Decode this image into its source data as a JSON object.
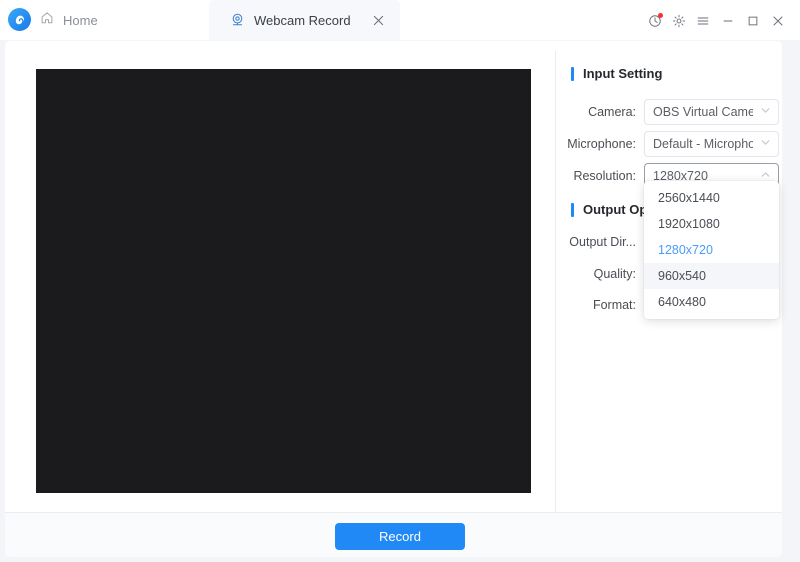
{
  "app": {
    "logo_icon": "app-logo-icon",
    "home_label": "Home"
  },
  "tab": {
    "icon": "webcam-icon",
    "label": "Webcam Record",
    "close_icon": "close-icon"
  },
  "window_controls": [
    {
      "name": "history-icon",
      "badge": true
    },
    {
      "name": "gear-icon",
      "badge": false
    },
    {
      "name": "menu-icon",
      "badge": false
    },
    {
      "name": "minimize-icon",
      "badge": false
    },
    {
      "name": "maximize-icon",
      "badge": false
    },
    {
      "name": "close-icon",
      "badge": false
    }
  ],
  "input_setting": {
    "title": "Input Setting",
    "camera_label": "Camera:",
    "camera_value": "OBS Virtual Camera",
    "microphone_label": "Microphone:",
    "microphone_value": "Default - Microphon...",
    "resolution_label": "Resolution:",
    "resolution_value": "1280x720"
  },
  "output_options": {
    "title": "Output Op",
    "output_dir_label": "Output Dir...",
    "quality_label": "Quality:",
    "format_label": "Format:"
  },
  "resolution_dropdown": {
    "options": [
      {
        "label": "2560x1440",
        "state": "normal"
      },
      {
        "label": "1920x1080",
        "state": "normal"
      },
      {
        "label": "1280x720",
        "state": "selected"
      },
      {
        "label": "960x540",
        "state": "hover"
      },
      {
        "label": "640x480",
        "state": "normal"
      }
    ]
  },
  "footer": {
    "record_label": "Record"
  },
  "colors": {
    "accent": "#2089f5",
    "selected_text": "#4a9cf8",
    "preview_bg": "#1b1b1d",
    "badge_red": "#f5332f",
    "page_bg": "#f3f5f9"
  }
}
